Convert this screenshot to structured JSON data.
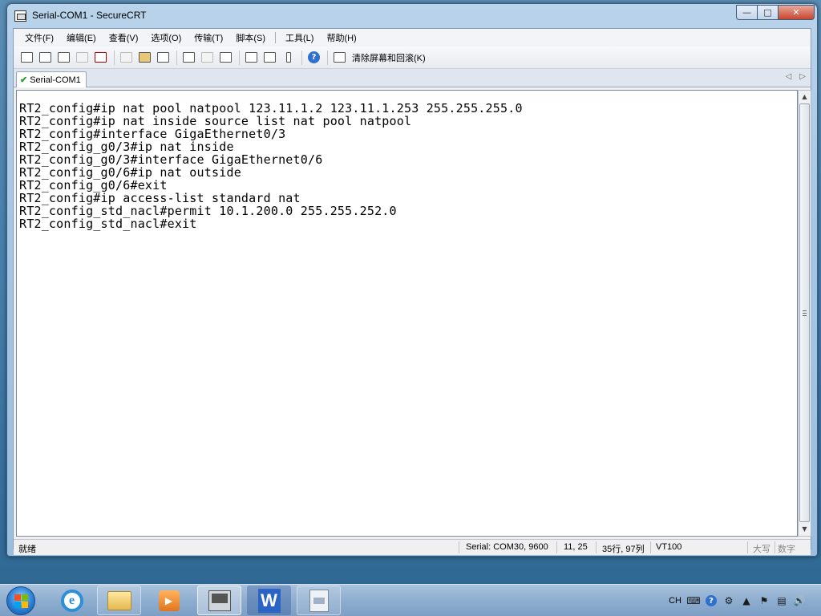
{
  "window": {
    "title": "Serial-COM1 - SecureCRT",
    "buttons": {
      "minimize": "—",
      "maximize": "□",
      "close": "✕"
    }
  },
  "menu": {
    "items": [
      "文件(F)",
      "编辑(E)",
      "查看(V)",
      "选项(O)",
      "传输(T)",
      "脚本(S)",
      "工具(L)",
      "帮助(H)"
    ]
  },
  "toolbar": {
    "help_glyph": "?",
    "clear_label": "清除屏幕和回滚(K)"
  },
  "tabs": [
    {
      "label": "Serial-COM1",
      "active": true
    }
  ],
  "tab_nav": {
    "left": "◁",
    "right": "▷"
  },
  "terminal": {
    "lines": [
      "RT2_config#ip nat pool natpool 123.11.1.2 123.11.1.253 255.255.255.0",
      "RT2_config#ip nat inside source list nat pool natpool",
      "RT2_config#interface GigaEthernet0/3",
      "RT2_config_g0/3#ip nat inside",
      "RT2_config_g0/3#interface GigaEthernet0/6",
      "RT2_config_g0/6#ip nat outside",
      "RT2_config_g0/6#exit",
      "RT2_config#ip access-list standard nat",
      "RT2_config_std_nacl#permit 10.1.200.0 255.255.252.0",
      "RT2_config_std_nacl#exit"
    ]
  },
  "scrollbar": {
    "up": "▲",
    "down": "▼"
  },
  "status": {
    "ready": "就绪",
    "connection": "Serial: COM30, 9600",
    "cursor": "11,  25",
    "size": "35行, 97列",
    "emulation": "VT100",
    "caps": "大写",
    "num": "数字"
  },
  "taskbar": {
    "ie_glyph": "e",
    "media_glyph": "▶",
    "wps_glyph": "W",
    "tray": {
      "language": "CH",
      "help_glyph": "?",
      "arrow": "▲",
      "volume": "🔊"
    }
  },
  "colors": {
    "terminal_bg": "#ffffff",
    "terminal_fg": "#000000",
    "window_frame": "#a6c6e4",
    "taskbar": "#8eaed0"
  }
}
